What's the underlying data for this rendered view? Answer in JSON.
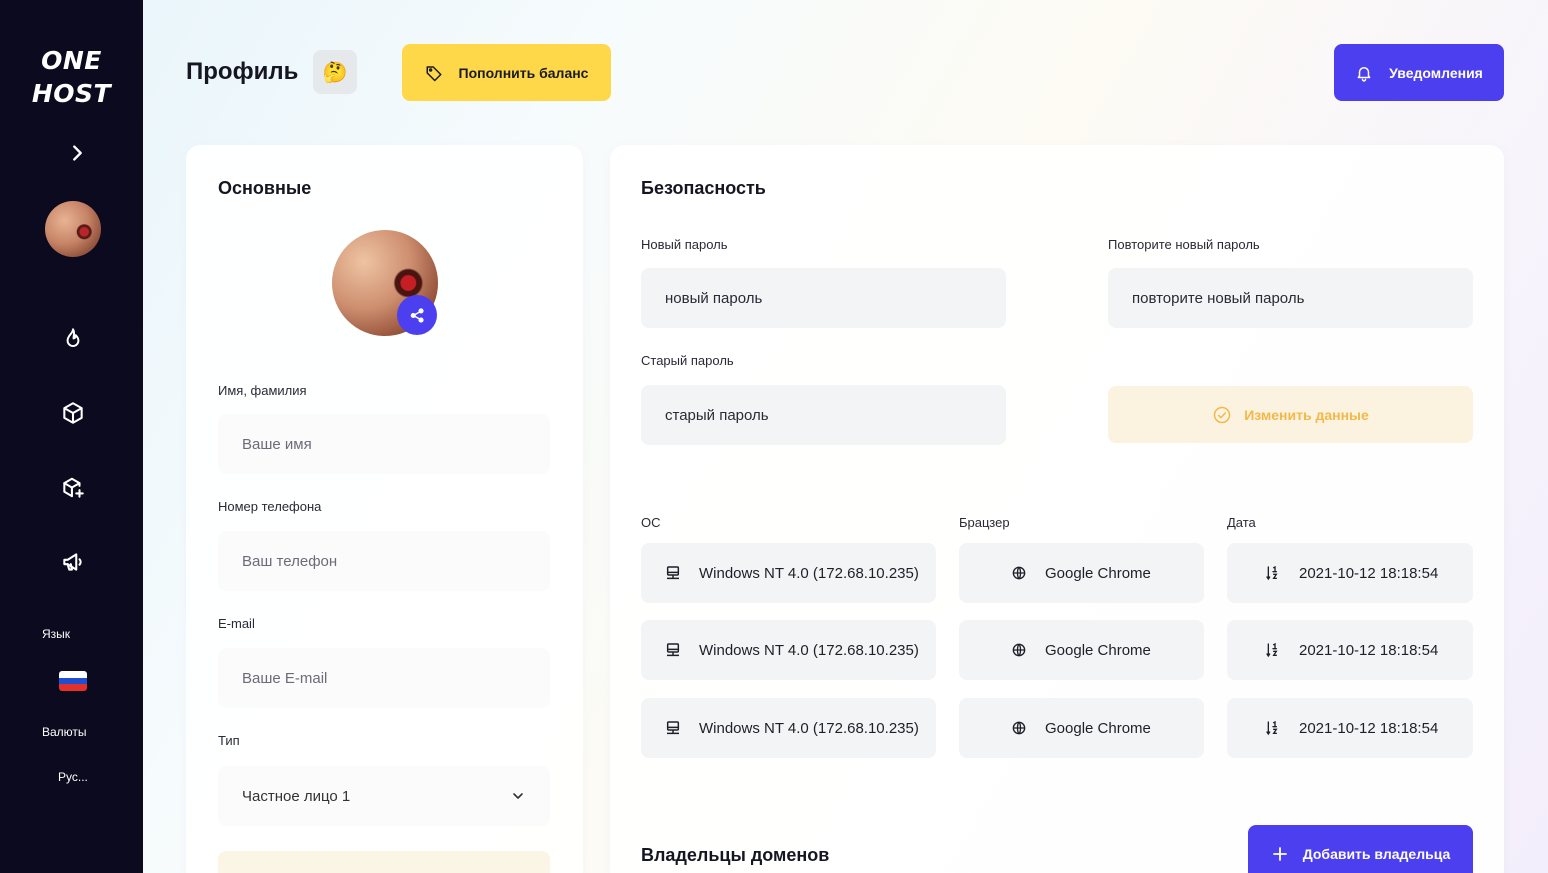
{
  "sidebar": {
    "logo_line1": "ONE",
    "logo_line2": "HOST",
    "expand_icon": "chevron-right-icon",
    "nav_icons": [
      "fire-icon",
      "box-icon",
      "box-add-icon",
      "megaphone-icon"
    ],
    "language_label": "Язык",
    "currency_label": "Валюты",
    "currency_value": "Рус..."
  },
  "header": {
    "title": "Профиль",
    "emoji": "🤔",
    "topup_label": "Пополнить баланс",
    "notifications_label": "Уведомления"
  },
  "basic": {
    "title": "Основные",
    "name_label": "Имя, фамилия",
    "name_placeholder": "Ваше имя",
    "phone_label": "Номер телефона",
    "phone_placeholder": "Ваш телефон",
    "email_label": "E-mail",
    "email_placeholder": "Ваше E-mail",
    "type_label": "Тип",
    "type_value": "Частное лицо 1"
  },
  "security": {
    "title": "Безопасность",
    "new_password_label": "Новый пароль",
    "new_password_placeholder": "новый пароль",
    "repeat_password_label": "Повторите новый пароль",
    "repeat_password_placeholder": "повторите новый пароль",
    "old_password_label": "Старый пароль",
    "old_password_placeholder": "старый пароль",
    "change_label": "Изменить данные",
    "sessions_headers": {
      "os": "ОС",
      "browser": "Брацзер",
      "date": "Дата"
    },
    "sessions": [
      {
        "os": "Windows NT 4.0 (172.68.10.235)",
        "browser": "Google Chrome",
        "date": "2021-10-12 18:18:54"
      },
      {
        "os": "Windows NT 4.0 (172.68.10.235)",
        "browser": "Google Chrome",
        "date": "2021-10-12 18:18:54"
      },
      {
        "os": "Windows NT 4.0 (172.68.10.235)",
        "browser": "Google Chrome",
        "date": "2021-10-12 18:18:54"
      }
    ]
  },
  "owners": {
    "title": "Владельцы доменов",
    "add_label": "Добавить владельца"
  },
  "colors": {
    "accent": "#4c3ff0",
    "yellow": "#ffd84a",
    "sidebar": "#0b0a1f",
    "warning_text": "#f4b84a"
  }
}
